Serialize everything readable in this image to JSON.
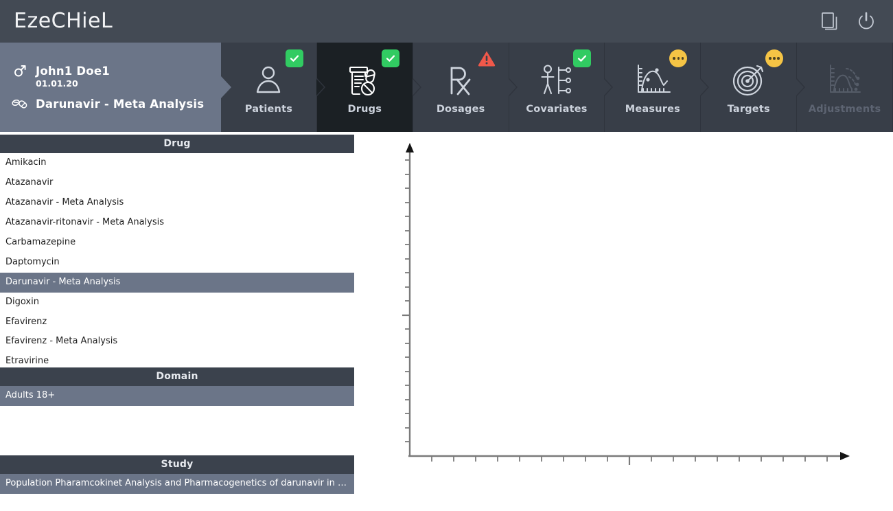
{
  "app": {
    "title": "EzeCHieL",
    "titlebar_icons": [
      {
        "name": "pages-copy-icon",
        "label": "Pages"
      },
      {
        "name": "power-icon",
        "label": "Power"
      }
    ]
  },
  "patient": {
    "gender_icon": "male-gender-icon",
    "name": "John1 Doe1",
    "birthdate": "01.01.20",
    "drug_icon": "pills-icon",
    "drug": "Darunavir - Meta Analysis"
  },
  "tabs": [
    {
      "label": "Patients",
      "icon": "person-icon",
      "status": "ok",
      "active": false,
      "disabled": false
    },
    {
      "label": "Drugs",
      "icon": "pills-bottle-icon",
      "status": "ok",
      "active": true,
      "disabled": false
    },
    {
      "label": "Dosages",
      "icon": "rx-icon",
      "status": "warn",
      "active": false,
      "disabled": false
    },
    {
      "label": "Covariates",
      "icon": "covariates-icon",
      "status": "ok",
      "active": false,
      "disabled": false
    },
    {
      "label": "Measures",
      "icon": "measures-icon",
      "status": "pending",
      "active": false,
      "disabled": false
    },
    {
      "label": "Targets",
      "icon": "target-icon",
      "status": "pending",
      "active": false,
      "disabled": false
    },
    {
      "label": "Adjustments",
      "icon": "adjustments-icon",
      "status": "none",
      "active": false,
      "disabled": true
    }
  ],
  "panels": {
    "drug": {
      "header": "Drug",
      "items": [
        {
          "label": "Amikacin",
          "selected": false
        },
        {
          "label": "Atazanavir",
          "selected": false
        },
        {
          "label": "Atazanavir - Meta Analysis",
          "selected": false
        },
        {
          "label": "Atazanavir-ritonavir - Meta Analysis",
          "selected": false
        },
        {
          "label": "Carbamazepine",
          "selected": false
        },
        {
          "label": "Daptomycin",
          "selected": false
        },
        {
          "label": "Darunavir - Meta Analysis",
          "selected": true
        },
        {
          "label": "Digoxin",
          "selected": false
        },
        {
          "label": "Efavirenz",
          "selected": false
        },
        {
          "label": "Efavirenz - Meta Analysis",
          "selected": false
        },
        {
          "label": "Etravirine",
          "selected": false
        }
      ]
    },
    "domain": {
      "header": "Domain",
      "items": [
        {
          "label": "Adults 18+",
          "selected": true
        }
      ]
    },
    "study": {
      "header": "Study",
      "items": [
        {
          "label": "Population Pharamcokinet Analysis and Pharmacogenetics of darunavir in HIV-po...",
          "selected": true
        }
      ]
    }
  },
  "colors": {
    "titlebar": "#434a54",
    "navstrip": "#383e48",
    "active_tab": "#1b2024",
    "patient_panel": "#6b7588",
    "selection": "#6b7588",
    "section_header": "#3b424d",
    "status_ok": "#31cb62",
    "status_warn": "#f0584a",
    "status_pending": "#f5c445",
    "axis": "#7a7a7a"
  },
  "chart_data": {
    "type": "line",
    "title": "",
    "xlabel": "",
    "ylabel": "",
    "series": [],
    "x": [],
    "values": [],
    "grid": false,
    "legend": "none",
    "empty": true,
    "axis": {
      "x_minor_ticks": 19,
      "x_major_tick_index": 9,
      "y_minor_ticks": 21,
      "y_major_tick_index": 10,
      "x_tick_labels": [],
      "y_tick_labels": [],
      "arrow_heads": [
        "x-right",
        "y-up"
      ]
    }
  }
}
